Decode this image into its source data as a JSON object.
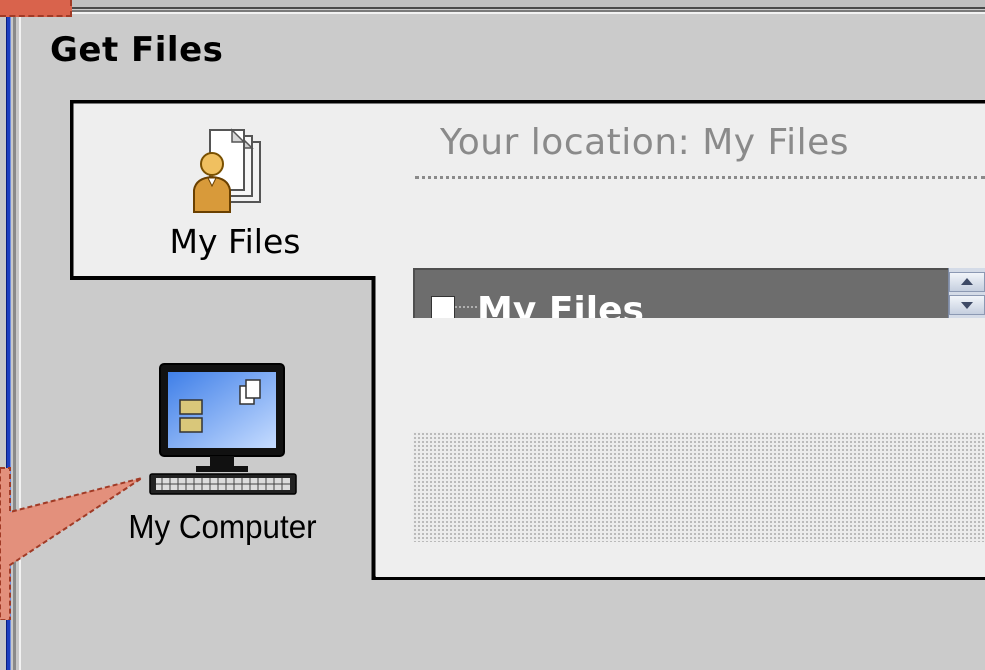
{
  "dialog": {
    "title": "Get Files"
  },
  "tabs": [
    {
      "label": "My Files",
      "icon": "my-files-icon",
      "selected": true
    },
    {
      "label": "My Computer",
      "icon": "computer-icon",
      "selected": false
    }
  ],
  "location": {
    "text": "Your location: My Files"
  },
  "tree": {
    "root_label": "My Files",
    "checkbox_checked": false
  },
  "colors": {
    "tree_header_bg": "#6d6d6d",
    "callout_fill": "#e3907c",
    "callout_border": "#a13a25",
    "frame_blue": "#1d3fbf"
  }
}
